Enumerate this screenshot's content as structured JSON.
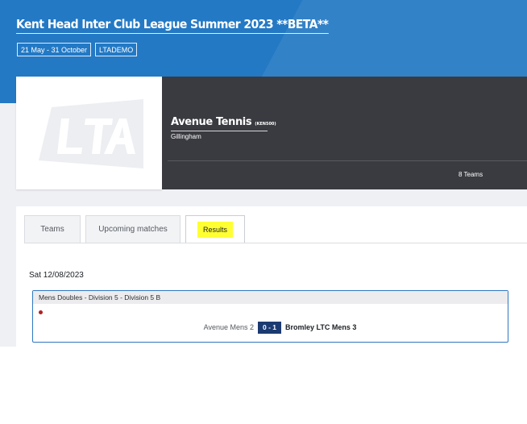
{
  "header": {
    "title": "Kent Head Inter Club League Summer 2023 **BETA**",
    "date_range": "21 May - 31 October",
    "organiser_code": "LTADEMO"
  },
  "club": {
    "logo_text": "LTA",
    "name": "Avenue Tennis",
    "code": "(KEN500)",
    "town": "Gillingham",
    "teams_count": "8 Teams"
  },
  "tabs": [
    {
      "label": "Teams",
      "active": false
    },
    {
      "label": "Upcoming matches",
      "active": false
    },
    {
      "label": "Results",
      "active": true
    }
  ],
  "results": {
    "date": "Sat 12/08/2023",
    "matches": [
      {
        "competition": "Mens Doubles - Division 5 - Division 5 B",
        "home": "Avenue Mens 2",
        "score": "0 - 1",
        "away": "Bromley LTC Mens 3"
      }
    ]
  },
  "colors": {
    "header_blue": "#2379c4",
    "dark_panel": "#3a3b40",
    "highlight": "#ffff33",
    "score_navy": "#1b3a72",
    "card_border": "#2f77c0",
    "live_dot": "#b42121"
  }
}
